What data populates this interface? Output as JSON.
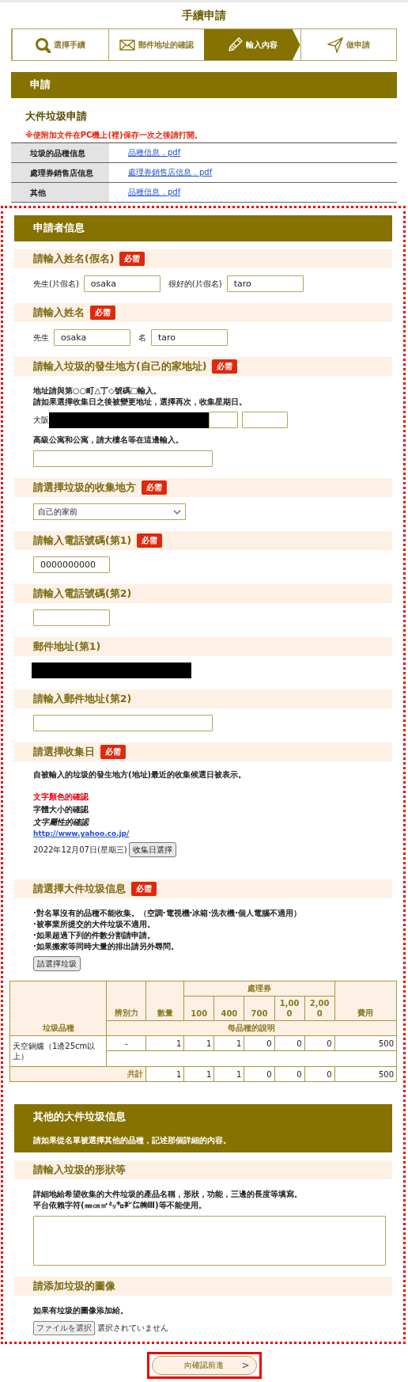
{
  "page_title": "手續申請",
  "steps": [
    {
      "label": "選擇手續",
      "kind": "search",
      "selected": false
    },
    {
      "label": "郵件地址的確認",
      "kind": "mail",
      "selected": false
    },
    {
      "label": "輸入內容",
      "kind": "input",
      "selected": true
    },
    {
      "label": "做申請",
      "kind": "send",
      "selected": false
    }
  ],
  "application": {
    "header": "申請",
    "title": "大件垃圾申請",
    "note": "※使附加文件在PC機上(裡)保存一次之後請打開。",
    "documents": [
      {
        "label": "垃圾的品種信息",
        "link": "品種信息．pdf"
      },
      {
        "label": "處理券銷售店信息",
        "link": "處理券銷售店信息．pdf"
      },
      {
        "label": "其他",
        "link": "品種信息．pdf"
      }
    ]
  },
  "applicant": {
    "header": "申請者信息",
    "sections": [
      {
        "kind": "pair_inputs",
        "heading": "請輸入姓名(假名)",
        "badge": "必需",
        "inputs": [
          {
            "label": "先生(片假名)",
            "value": "osaka"
          },
          {
            "label": "很好的(片假名)",
            "value": "taro"
          }
        ]
      },
      {
        "kind": "pair_inputs",
        "heading": "請輸入姓名",
        "badge": "必需",
        "inputs": [
          {
            "label": "先生",
            "value": "osaka"
          },
          {
            "label": "名",
            "value": "taro"
          }
        ]
      },
      {
        "kind": "address",
        "heading": "請輸入垃圾的發生地方(自己的家地址)",
        "badge": "必需",
        "lines": [
          "地址請與第○○町△丁◇號碼□輸入。",
          "請如果選擇收集日之後被變更地址，選擇再次，收集星期日。"
        ],
        "prefix": "大阪",
        "building_note": "高級公寓和公寓，請大樓名等在這邊輸入。"
      },
      {
        "kind": "select",
        "heading": "請選擇垃圾的收集地方",
        "badge": "必需",
        "value": "自己的家前"
      },
      {
        "kind": "phone",
        "heading": "請輸入電話號碼(第1)",
        "badge": "必需",
        "value": "0000000000"
      },
      {
        "kind": "phone",
        "heading": "請輸入電話號碼(第2)"
      },
      {
        "kind": "email_redacted",
        "heading": "郵件地址(第1)"
      },
      {
        "kind": "email",
        "heading": "請輸入郵件地址(第2)"
      },
      {
        "kind": "date",
        "heading": "請選擇收集日",
        "badge": "必需",
        "description": "自被輸入的垃圾的發生地方(地址)最近的收集候選日被表示。",
        "samples": [
          {
            "kind": "red",
            "text": "文字顏色的確認"
          },
          {
            "kind": "bold",
            "text": "字體大小的確認"
          },
          {
            "kind": "italic",
            "text": "文字屬性的確認"
          },
          {
            "kind": "link",
            "text": "http://www.yahoo.co.jp/"
          }
        ],
        "date": "2022年12月07日(星期三)",
        "button": "收集日選擇"
      },
      {
        "kind": "items",
        "heading": "請選擇大件垃圾信息",
        "badge": "必需",
        "lines": [
          "·對名單沒有的品種不能收集。（空調·電視機·冰箱·洗衣機·個人電腦不適用）",
          "·被事業所提交的大件垃圾不適用。",
          "·如果超過下列的件數分割請申請。",
          "·如果搬家等同時大量的排出請另外尋問。"
        ],
        "button": "請選擇垃圾",
        "table": {
          "item": "垃圾品種",
          "distinction": "辨別力",
          "quantity": "數量",
          "tickets": "處理券",
          "ticket_values": [
            "100",
            "400",
            "700",
            "1,000",
            "2,000"
          ],
          "fee": "費用",
          "description": "每品種的說明",
          "rows": [
            {
              "item": "天空鍋爐（1邊25cm以上）",
              "distinction": "-",
              "quantity": "1",
              "tickets": [
                "1",
                "1",
                "0",
                "0",
                "0"
              ],
              "fee": "500"
            }
          ],
          "total": {
            "label": "共計",
            "quantity": "1",
            "tickets": [
              "1",
              "1",
              "0",
              "0",
              "0"
            ],
            "fee": "500"
          }
        }
      }
    ]
  },
  "other": {
    "header": "其他的大件垃圾信息",
    "subtext": "請如果從名單被選擇其他的品種，記述那個詳細的內容。",
    "sections": [
      {
        "kind": "textarea",
        "heading": "請輸入垃圾的形狀等",
        "lines": [
          "詳細地給希望收集的大件垃圾的產品名稱，形狀，功能，三邊的長度等填寫。",
          "平台依賴字符(㎜㎝㎡㍉㌔㌢㍍㈱Ⅲ)等不能使用。"
        ]
      },
      {
        "kind": "file",
        "heading": "請添加垃圾的圖像",
        "lines": [
          "如果有垃圾的圖像添加給。"
        ],
        "file_button": "ファイルを選択",
        "file_status": "選択されていません"
      }
    ]
  },
  "submit": {
    "label": "向確認前進",
    "arrow": ">"
  }
}
